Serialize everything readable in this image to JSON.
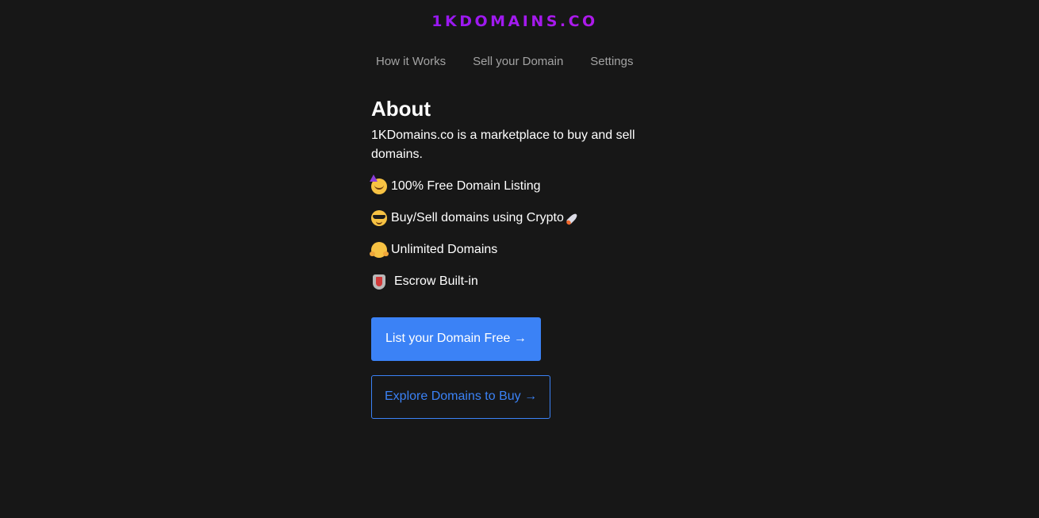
{
  "header": {
    "logo": "1KDOMAINS.CO"
  },
  "nav": {
    "items": [
      "How it Works",
      "Sell your Domain",
      "Settings"
    ]
  },
  "about": {
    "title": "About",
    "description": "1KDomains.co is a marketplace to buy and sell domains.",
    "features": [
      {
        "icon": "partying-face-icon",
        "label": "100% Free Domain Listing"
      },
      {
        "icon": "sunglasses-face-icon",
        "label": "Buy/Sell domains using Crypto"
      },
      {
        "icon": "hugging-face-icon",
        "label": "Unlimited Domains"
      },
      {
        "icon": "shield-icon",
        "label": "Escrow Built-in"
      }
    ],
    "trailing_icon": "rocket-icon"
  },
  "buttons": {
    "primary_label": "List your Domain Free →",
    "secondary_label": "Explore Domains to Buy →"
  },
  "colors": {
    "background": "#171717",
    "accent": "#3b82f6",
    "logo_gradient_start": "#5b0ff5",
    "logo_gradient_end": "#e81ec8",
    "nav_text": "#a3a3a3"
  }
}
